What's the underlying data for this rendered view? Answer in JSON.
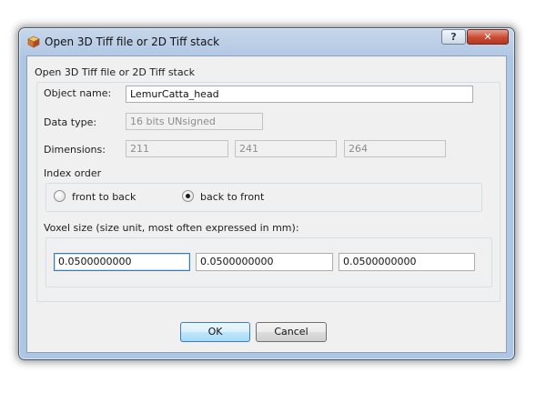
{
  "window": {
    "title": "Open 3D Tiff file or 2D Tiff stack",
    "help_label": "?",
    "close_label": "✕"
  },
  "group": {
    "title": "Open 3D Tiff file or 2D Tiff stack"
  },
  "object_name": {
    "label": "Object name:",
    "value": "LemurCatta_head"
  },
  "data_type": {
    "label": "Data type:",
    "value": "16 bits UNsigned"
  },
  "dimensions": {
    "label": "Dimensions:",
    "values": [
      "211",
      "241",
      "264"
    ]
  },
  "index_order": {
    "label": "Index order",
    "options": [
      {
        "label": "front to back",
        "selected": false
      },
      {
        "label": "back to front",
        "selected": true
      }
    ]
  },
  "voxel_size": {
    "label": "Voxel size (size unit, most often expressed in mm):",
    "values": [
      "0.0500000000",
      "0.0500000000",
      "0.0500000000"
    ]
  },
  "buttons": {
    "ok": "OK",
    "cancel": "Cancel"
  }
}
